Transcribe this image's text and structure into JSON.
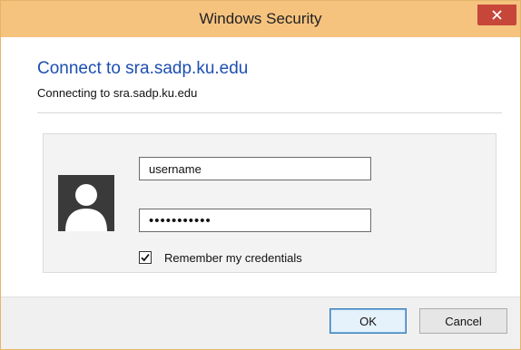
{
  "window": {
    "title": "Windows Security",
    "close_icon": "close-icon"
  },
  "header": {
    "heading": "Connect to sra.sadp.ku.edu",
    "subheading": "Connecting to sra.sadp.ku.edu"
  },
  "credentials": {
    "avatar_icon": "user-avatar-icon",
    "username_value": "username",
    "password_value": "•••••••••••",
    "remember_label": "Remember my credentials",
    "remember_checked": true
  },
  "buttons": {
    "ok_label": "OK",
    "cancel_label": "Cancel"
  },
  "colors": {
    "titlebar": "#f6c37f",
    "close_button": "#c7463a",
    "heading": "#1d4fb0"
  }
}
